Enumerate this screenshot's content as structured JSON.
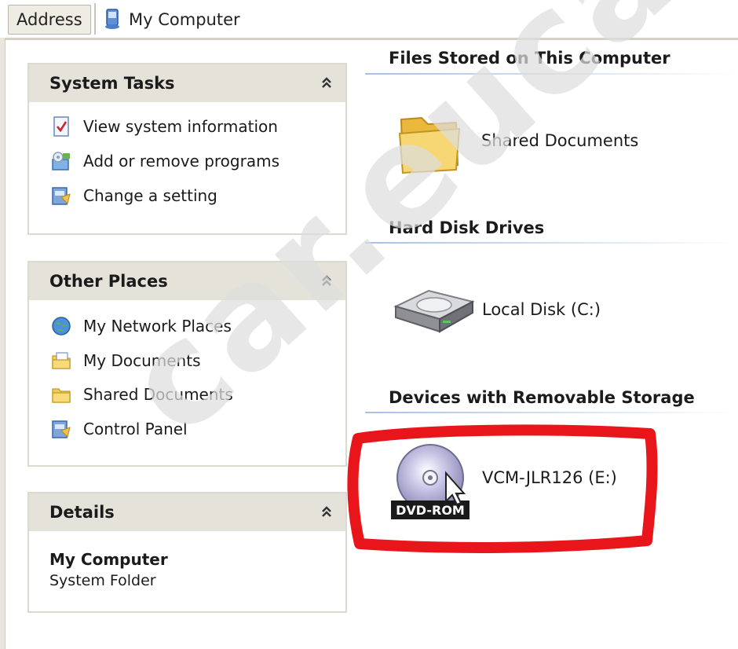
{
  "address_bar": {
    "label": "Address",
    "location": "My Computer"
  },
  "panels": {
    "system_tasks": {
      "title": "System Tasks",
      "items": [
        {
          "label": "View system information",
          "icon": "system-info-icon"
        },
        {
          "label": "Add or remove programs",
          "icon": "add-remove-programs-icon"
        },
        {
          "label": "Change a setting",
          "icon": "control-panel-icon"
        }
      ]
    },
    "other_places": {
      "title": "Other Places",
      "items": [
        {
          "label": "My Network Places",
          "icon": "network-places-icon"
        },
        {
          "label": "My Documents",
          "icon": "my-documents-icon"
        },
        {
          "label": "Shared Documents",
          "icon": "folder-icon"
        },
        {
          "label": "Control Panel",
          "icon": "control-panel-icon"
        }
      ]
    },
    "details": {
      "title": "Details",
      "name": "My Computer",
      "subtitle": "System Folder"
    }
  },
  "content": {
    "groups": [
      {
        "heading": "Files Stored on This Computer",
        "items": [
          {
            "label": "Shared Documents",
            "icon": "large-folder-icon"
          }
        ]
      },
      {
        "heading": "Hard Disk Drives",
        "items": [
          {
            "label": "Local Disk (C:)",
            "icon": "hard-disk-icon"
          }
        ]
      },
      {
        "heading": "Devices with Removable Storage",
        "items": [
          {
            "label": "VCM-JLR126 (E:)",
            "icon": "dvd-rom-icon",
            "badge": "DVD-ROM"
          }
        ]
      }
    ]
  },
  "watermark": "car.eucar.co",
  "colors": {
    "panel_header": "#e5e2da",
    "group_rule": "#a9c0e3",
    "highlight": "#e8161b"
  }
}
